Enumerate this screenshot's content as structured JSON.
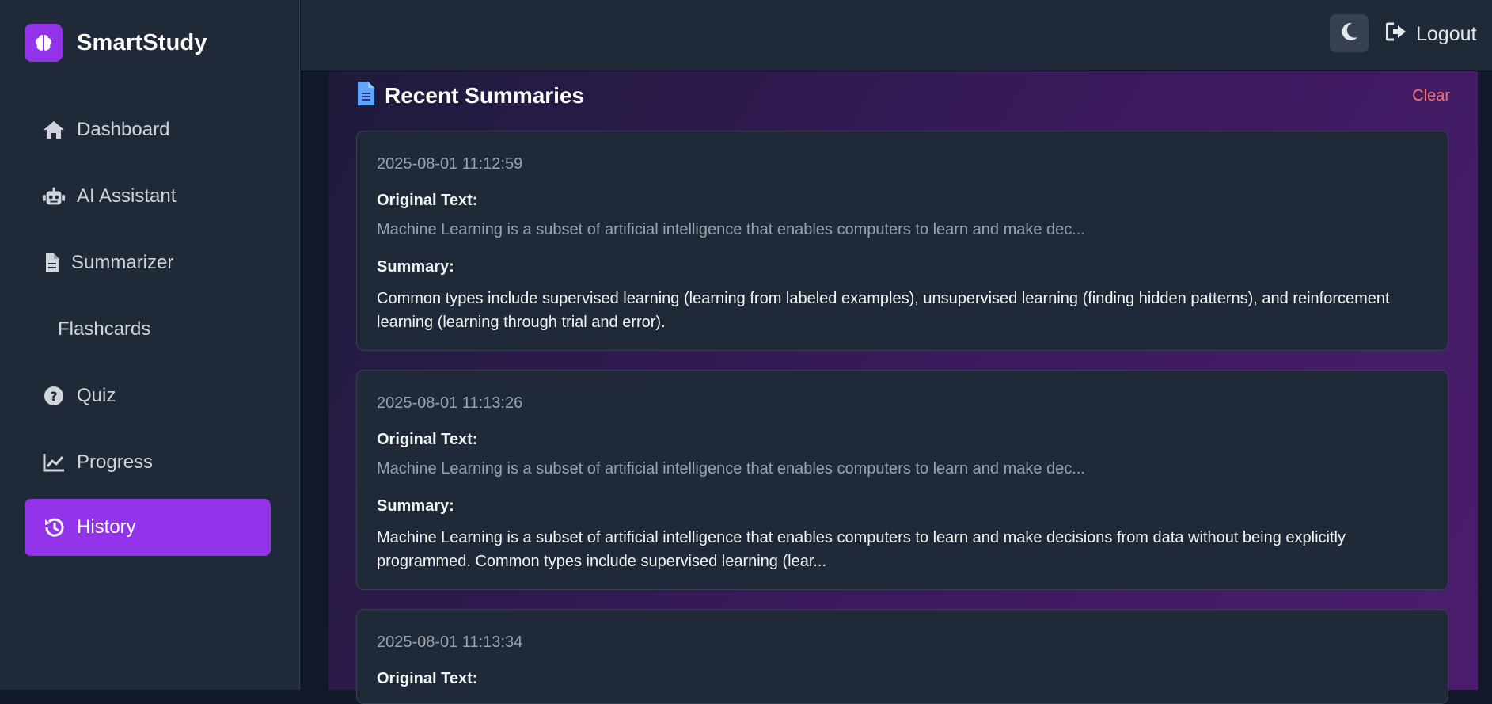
{
  "brand": {
    "name": "SmartStudy",
    "accent": "#9333ea"
  },
  "sidebar": {
    "items": [
      {
        "label": "Dashboard",
        "icon": "home-icon",
        "active": false
      },
      {
        "label": "AI Assistant",
        "icon": "robot-icon",
        "active": false
      },
      {
        "label": "Summarizer",
        "icon": "file-icon",
        "active": false
      },
      {
        "label": "Flashcards",
        "icon": "",
        "active": false
      },
      {
        "label": "Quiz",
        "icon": "question-circle-icon",
        "active": false
      },
      {
        "label": "Progress",
        "icon": "chart-line-icon",
        "active": false
      },
      {
        "label": "History",
        "icon": "history-icon",
        "active": true
      }
    ]
  },
  "header": {
    "theme_icon": "moon-icon",
    "logout_label": "Logout",
    "logout_icon": "sign-out-icon"
  },
  "main": {
    "section_title": "Recent Summaries",
    "section_icon": "file-icon",
    "clear_label": "Clear",
    "original_label": "Original Text:",
    "summary_label": "Summary:",
    "cards": [
      {
        "timestamp": "2025-08-01 11:12:59",
        "original": "Machine Learning is a subset of artificial intelligence that enables computers to learn and make dec...",
        "summary": "Common types include supervised learning (learning from labeled examples), unsupervised learning (finding hidden patterns), and reinforcement learning (learning through trial and error)."
      },
      {
        "timestamp": "2025-08-01 11:13:26",
        "original": "Machine Learning is a subset of artificial intelligence that enables computers to learn and make dec...",
        "summary": "Machine Learning is a subset of artificial intelligence that enables computers to learn and make decisions from data without being explicitly programmed. Common types include supervised learning (lear..."
      },
      {
        "timestamp": "2025-08-01 11:13:34",
        "original": "",
        "summary": ""
      }
    ]
  },
  "colors": {
    "danger": "#f87171",
    "sidebar_bg": "#1f2937",
    "page_bg": "#111827"
  }
}
